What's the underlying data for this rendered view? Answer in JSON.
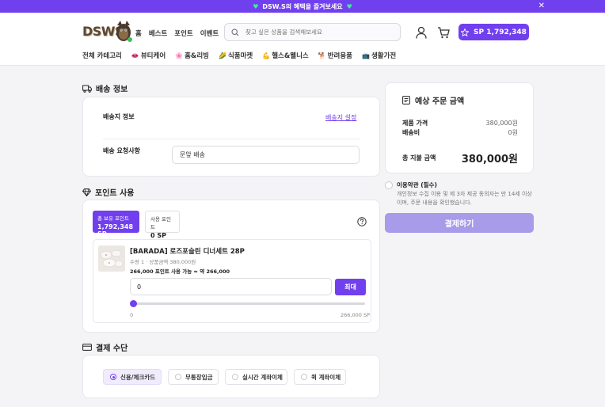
{
  "promo": {
    "text": "DSW.S의 혜택을 즐겨보세요"
  },
  "header": {
    "logo_text": "DSWS",
    "nav": [
      "홈",
      "베스트",
      "포인트",
      "이벤트"
    ],
    "search_placeholder": "찾고 싶은 상품을 검색해보세요",
    "sp_label": "SP 1,792,348",
    "categories": [
      {
        "icon": "",
        "label": "전체 카테고리"
      },
      {
        "icon": "lips-icon",
        "label": "뷰티케어"
      },
      {
        "icon": "flower-icon",
        "label": "홈&리빙"
      },
      {
        "icon": "corn-icon",
        "label": "식품마켓"
      },
      {
        "icon": "muscle-icon",
        "label": "헬스&웰니스"
      },
      {
        "icon": "dog-icon",
        "label": "반려용품"
      },
      {
        "icon": "tv-icon",
        "label": "생활가전"
      }
    ]
  },
  "shipping": {
    "title": "배송 정보",
    "address_label": "배송지 정보",
    "set_link": "배송지 설정",
    "request_label": "배송 요청사항",
    "request_value": "문앞 배송"
  },
  "points": {
    "title": "포인트 사용",
    "owned_label": "총 보유 포인트",
    "owned_value": "1,792,348 SP",
    "used_label": "사용 포인트",
    "used_value": "0 SP",
    "product_name": "[BARADA] 로즈포슬린 디너세트 28P",
    "product_meta": "수량 1 · 상품금액 380,000원",
    "available": "266,000 포인트 사용 가능 ≈ 약 266,000",
    "input_value": "0",
    "max_button": "최대",
    "slider_min": "0",
    "slider_max": "266,000 SP",
    "slider_fraction": 0
  },
  "payment": {
    "title": "결제 수단",
    "options": [
      {
        "label": "신용/체크카드",
        "selected": true
      },
      {
        "label": "무통장입금",
        "selected": false
      },
      {
        "label": "실시간 계좌이체",
        "selected": false
      },
      {
        "label": "퀵 계좌이체",
        "selected": false
      }
    ]
  },
  "summary": {
    "title": "예상 주문 금액",
    "product_price_label": "제품 가격",
    "product_price_value": "380,000원",
    "shipping_fee_label": "배송비",
    "shipping_fee_value": "0원",
    "total_label": "총 지불 금액",
    "total_value": "380,000원"
  },
  "terms": {
    "title": "이용약관 (필수)",
    "desc": "개인정보 수집 이용 및 제 3자 제공 동의자는 만 14세 이상이며, 주문 내용을 확인했습니다."
  },
  "checkout": {
    "label": "결제하기"
  },
  "colors": {
    "accent": "#7140ee",
    "accent_disabled": "#a89bea",
    "promo_heart": "#4be3a8"
  }
}
